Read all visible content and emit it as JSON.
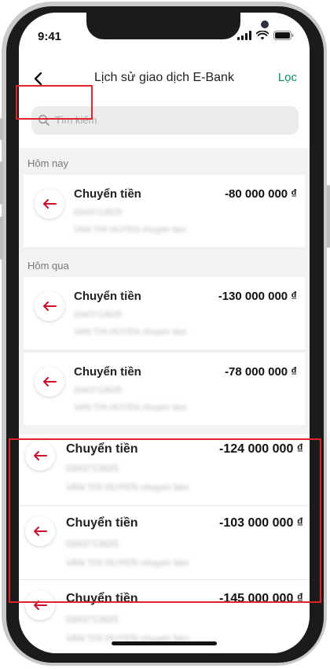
{
  "status_bar": {
    "time": "9:41"
  },
  "header": {
    "title": "Lịch sử giao dịch E-Bank",
    "filter_label": "Lọc"
  },
  "search": {
    "placeholder": "Tìm kiếm"
  },
  "sections": [
    {
      "label": "Hôm nay"
    },
    {
      "label": "Hôm qua"
    }
  ],
  "transactions": [
    {
      "title": "Chuyển tiền",
      "amount": "-80 000 000 ₫",
      "account": "0343713625",
      "description": "VAN THI HUYEN chuyen tien"
    },
    {
      "title": "Chuyển tiền",
      "amount": "-130 000 000 ₫",
      "account": "0343713625",
      "description": "VAN THI HUYEN chuyen tien"
    },
    {
      "title": "Chuyển tiền",
      "amount": "-78 000 000 ₫",
      "account": "0343713625",
      "description": "VAN THI HUYEN chuyen tien"
    },
    {
      "title": "Chuyển tiền",
      "amount": "-124 000 000 ₫",
      "account": "0343713625",
      "description": "VAN THI HUYEN chuyen tien"
    },
    {
      "title": "Chuyển tiền",
      "amount": "-103 000 000 ₫",
      "account": "0343713625",
      "description": "VAN THI HUYEN chuyen tien"
    },
    {
      "title": "Chuyển tiền",
      "amount": "-145 000 000 ₫",
      "account": "0343713625",
      "description": "VAN THI HUYEN chuyen tien"
    }
  ],
  "colors": {
    "accent": "#0f8a5f",
    "outgoing_arrow": "#c8102e",
    "highlight": "#e0242d"
  }
}
